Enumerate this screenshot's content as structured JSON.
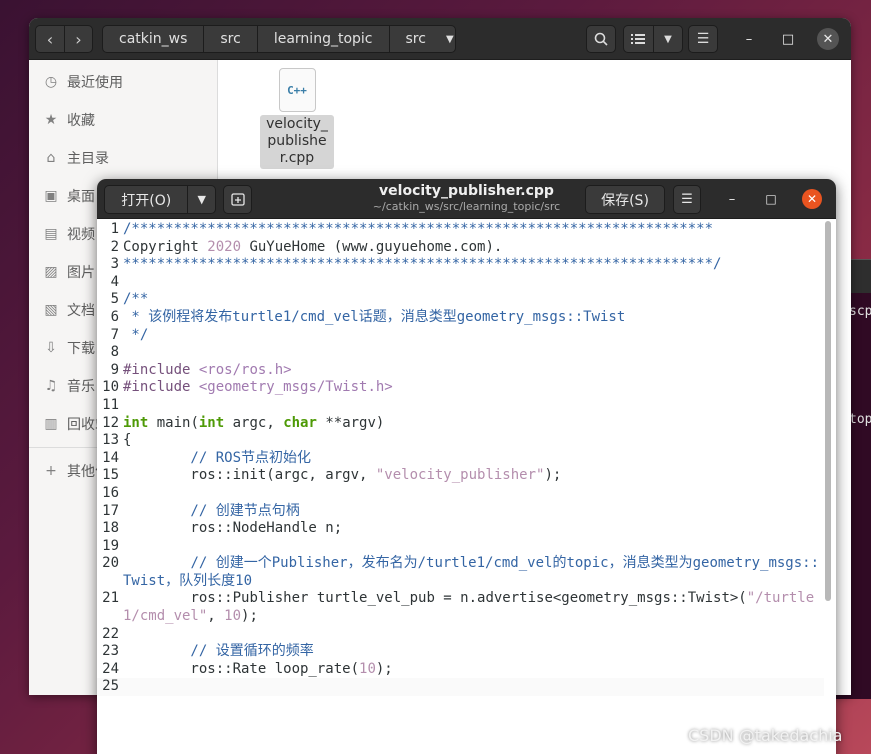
{
  "file_manager": {
    "breadcrumbs": [
      "catkin_ws",
      "src",
      "learning_topic",
      "src"
    ],
    "sidebar": [
      {
        "label": "最近使用",
        "icon": "clock-icon",
        "glyph": "◷"
      },
      {
        "label": "收藏",
        "icon": "star-icon",
        "glyph": "★"
      },
      {
        "label": "主目录",
        "icon": "home-icon",
        "glyph": "⌂"
      },
      {
        "label": "桌面",
        "icon": "desktop-icon",
        "glyph": "▣"
      },
      {
        "label": "视频",
        "icon": "video-icon",
        "glyph": "▤"
      },
      {
        "label": "图片",
        "icon": "image-icon",
        "glyph": "▨"
      },
      {
        "label": "文档",
        "icon": "document-icon",
        "glyph": "▧"
      },
      {
        "label": "下载",
        "icon": "download-icon",
        "glyph": "⇩"
      },
      {
        "label": "音乐",
        "icon": "music-icon",
        "glyph": "♫"
      },
      {
        "label": "回收站",
        "icon": "trash-icon",
        "glyph": "▥"
      },
      {
        "label": "其他位置",
        "icon": "plus-icon",
        "glyph": "+"
      }
    ],
    "file": {
      "icon_text": "C++",
      "name": "velocity_publisher.cpp"
    }
  },
  "editor": {
    "open_label": "打开(O)",
    "title": "velocity_publisher.cpp",
    "path": "~/catkin_ws/src/learning_topic/src",
    "save_label": "保存(S)",
    "lines": [
      {
        "n": "1",
        "t": "/*********************************************************************"
      },
      {
        "n": "2",
        "t": "Copyright 2020 GuYueHome (www.guyuehome.com)."
      },
      {
        "n": "3",
        "t": "**********************************************************************/"
      },
      {
        "n": "4",
        "t": ""
      },
      {
        "n": "5",
        "t": "/**"
      },
      {
        "n": "6",
        "t": " * 该例程将发布turtle1/cmd_vel话题，消息类型geometry_msgs::Twist"
      },
      {
        "n": "7",
        "t": " */"
      },
      {
        "n": "8",
        "t": ""
      },
      {
        "n": "9",
        "t": "#include <ros/ros.h>"
      },
      {
        "n": "10",
        "t": "#include <geometry_msgs/Twist.h>"
      },
      {
        "n": "11",
        "t": ""
      },
      {
        "n": "12",
        "t": "int main(int argc, char **argv)"
      },
      {
        "n": "13",
        "t": "{"
      },
      {
        "n": "14",
        "t": "        // ROS节点初始化"
      },
      {
        "n": "15",
        "t": "        ros::init(argc, argv, \"velocity_publisher\");"
      },
      {
        "n": "16",
        "t": ""
      },
      {
        "n": "17",
        "t": "        // 创建节点句柄"
      },
      {
        "n": "18",
        "t": "        ros::NodeHandle n;"
      },
      {
        "n": "19",
        "t": ""
      },
      {
        "n": "20",
        "t": "        // 创建一个Publisher，发布名为/turtle1/cmd_vel的topic，消息类型为geometry_msgs::Twist，队列长度10"
      },
      {
        "n": "21",
        "t": "        ros::Publisher turtle_vel_pub = n.advertise<geometry_msgs::Twist>(\"/turtle1/cmd_vel\", 10);"
      },
      {
        "n": "22",
        "t": ""
      },
      {
        "n": "23",
        "t": "        // 设置循环的频率"
      },
      {
        "n": "24",
        "t": "        ros::Rate loop_rate(10);"
      },
      {
        "n": "25",
        "t": ""
      }
    ]
  },
  "terminal_fragments": [
    "scp",
    "top"
  ],
  "watermark": "CSDN @takedachia",
  "colors": {
    "close_accent": "#e95420",
    "comment": "#3465a4",
    "preprocessor": "#75507b",
    "keyword": "#a40000",
    "type": "#4e9a06",
    "string": "#b48ead"
  }
}
